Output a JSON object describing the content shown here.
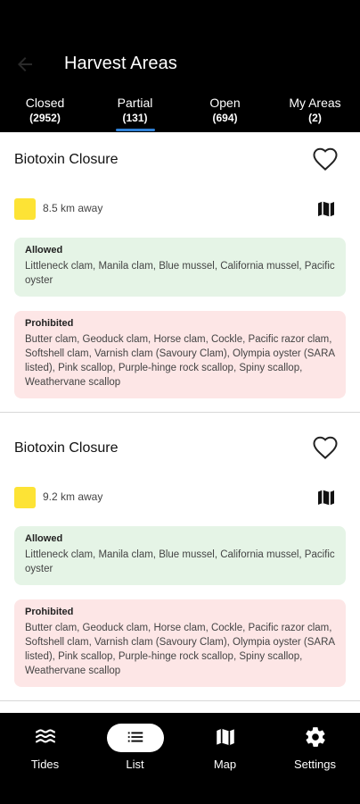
{
  "header": {
    "title": "Harvest Areas"
  },
  "tabs": [
    {
      "label": "Closed",
      "count": "(2952)"
    },
    {
      "label": "Partial",
      "count": "(131)"
    },
    {
      "label": "Open",
      "count": "(694)"
    },
    {
      "label": "My Areas",
      "count": "(2)"
    }
  ],
  "selected_tab": "Partial",
  "cards": [
    {
      "title": "Biotoxin Closure",
      "distance": "8.5 km away",
      "allowed_label": "Allowed",
      "allowed_text": "Littleneck clam, Manila clam, Blue mussel, California mussel, Pacific oyster",
      "prohibited_label": "Prohibited",
      "prohibited_text": "Butter clam, Geoduck clam, Horse clam, Cockle, Pacific razor clam, Softshell clam, Varnish clam (Savoury Clam), Olympia oyster (SARA listed), Pink scallop, Purple-hinge rock scallop, Spiny scallop, Weathervane scallop"
    },
    {
      "title": "Biotoxin Closure",
      "distance": "9.2 km away",
      "allowed_label": "Allowed",
      "allowed_text": "Littleneck clam, Manila clam, Blue mussel, California mussel, Pacific oyster",
      "prohibited_label": "Prohibited",
      "prohibited_text": "Butter clam, Geoduck clam, Horse clam, Cockle, Pacific razor clam, Softshell clam, Varnish clam (Savoury Clam), Olympia oyster (SARA listed), Pink scallop, Purple-hinge rock scallop, Spiny scallop, Weathervane scallop"
    }
  ],
  "nav": [
    {
      "label": "Tides",
      "icon": "waves-icon"
    },
    {
      "label": "List",
      "icon": "list-icon"
    },
    {
      "label": "Map",
      "icon": "map-icon"
    },
    {
      "label": "Settings",
      "icon": "gear-icon"
    }
  ],
  "selected_nav": "List",
  "colors": {
    "status_yellow": "#fde335",
    "allowed_bg": "#e5f4e6",
    "prohibited_bg": "#fde6e6",
    "tab_indicator": "#2f80d5"
  }
}
